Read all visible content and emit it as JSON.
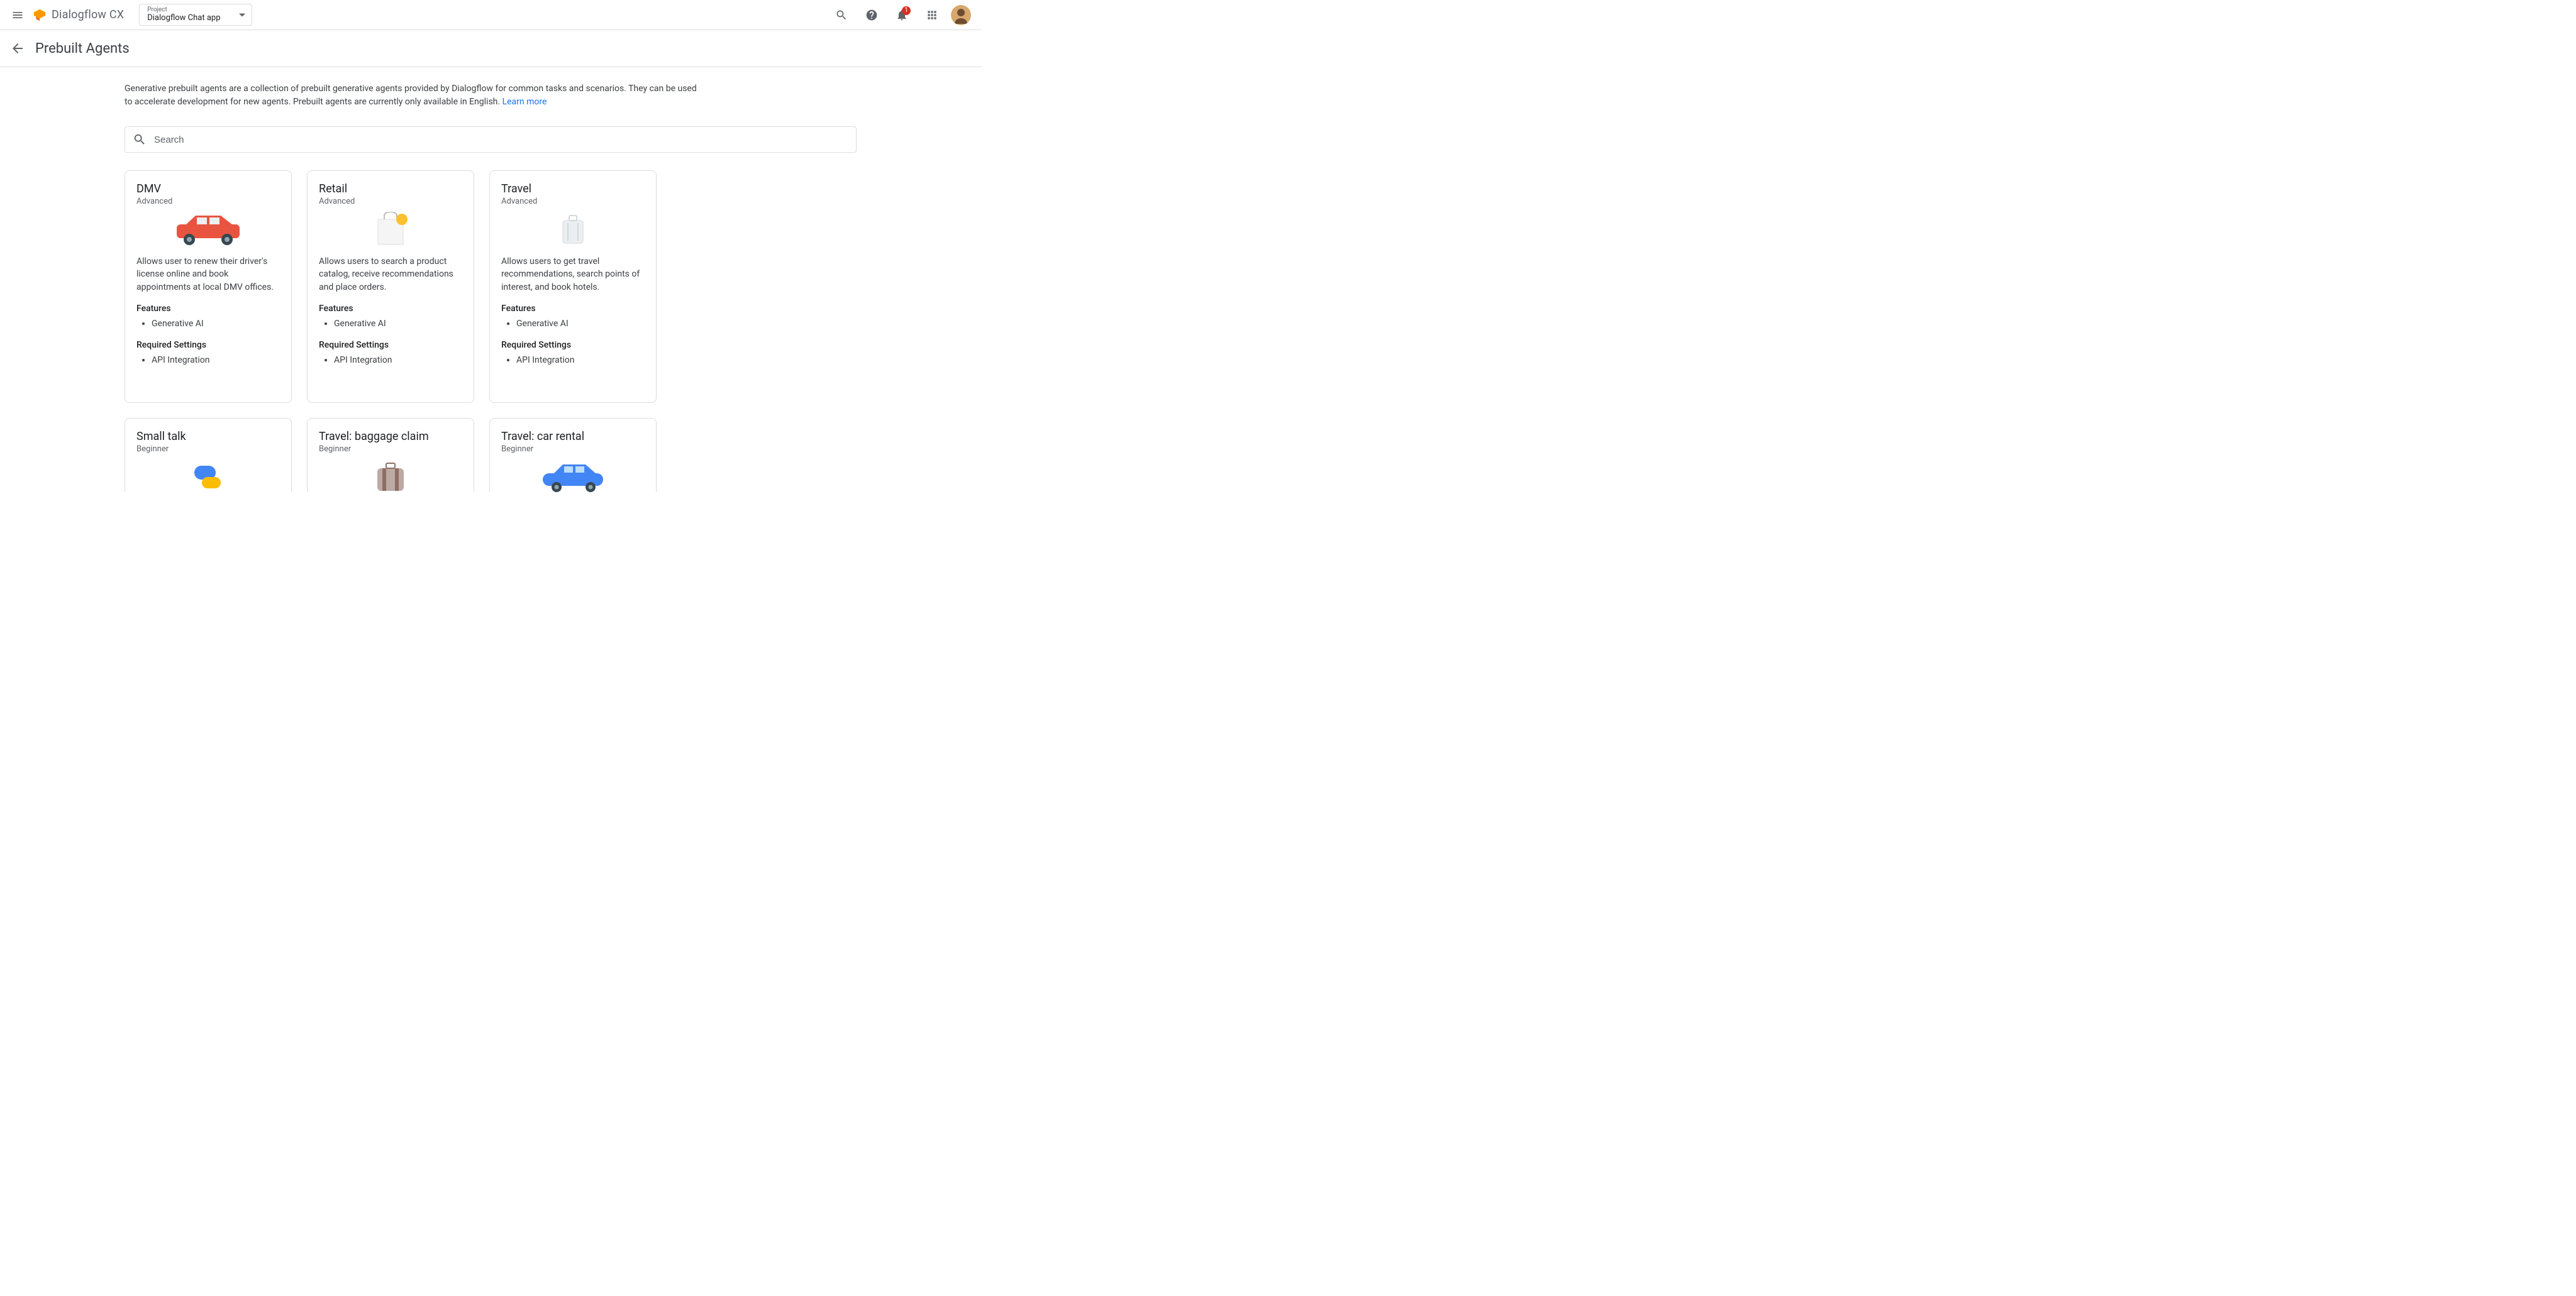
{
  "header": {
    "product_name": "Dialogflow CX",
    "project_label": "Project",
    "project_value": "Dialogflow Chat app",
    "notification_count": "1"
  },
  "page": {
    "title": "Prebuilt Agents",
    "intro_text": "Generative prebuilt agents are a collection of prebuilt generative agents provided by Dialogflow for common tasks and scenarios. They can be used to accelerate development for new agents. Prebuilt agents are currently only available in English. ",
    "learn_more": "Learn more",
    "search_placeholder": "Search"
  },
  "labels": {
    "features": "Features",
    "required_settings": "Required Settings",
    "advanced": "Advanced",
    "beginner": "Beginner",
    "gen_ai": "Generative AI",
    "api_integration": "API Integration"
  },
  "cards": [
    {
      "title": "DMV",
      "level": "Advanced",
      "desc": "Allows user to renew their driver's license online and book appointments at local DMV offices.",
      "features": [
        "Generative AI"
      ],
      "required": [
        "API Integration"
      ],
      "art": "car-red"
    },
    {
      "title": "Retail",
      "level": "Advanced",
      "desc": "Allows users to search a product catalog, receive recommendations and place orders.",
      "features": [
        "Generative AI"
      ],
      "required": [
        "API Integration"
      ],
      "art": "shopping-bag"
    },
    {
      "title": "Travel",
      "level": "Advanced",
      "desc": "Allows users to get travel recommendations, search points of interest, and book hotels.",
      "features": [
        "Generative AI"
      ],
      "required": [
        "API Integration"
      ],
      "art": "suitcase-gray"
    },
    {
      "title": "Small talk",
      "level": "Beginner",
      "desc": "",
      "features": [],
      "required": [],
      "art": "chat-bubbles"
    },
    {
      "title": "Travel: baggage claim",
      "level": "Beginner",
      "desc": "",
      "features": [],
      "required": [],
      "art": "suitcase-brown"
    },
    {
      "title": "Travel: car rental",
      "level": "Beginner",
      "desc": "",
      "features": [],
      "required": [],
      "art": "car-blue"
    }
  ]
}
